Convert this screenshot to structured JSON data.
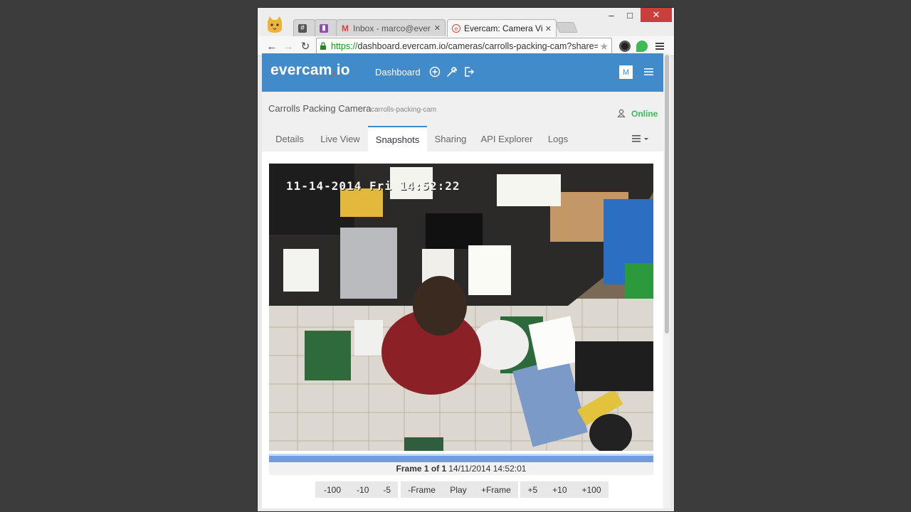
{
  "browser": {
    "tabs": [
      {
        "label": "",
        "icon": "hashtag-icon"
      },
      {
        "label": "",
        "icon": "trello-icon"
      },
      {
        "label": "Inbox - marco@ever",
        "icon": "gmail-icon"
      },
      {
        "label": "Evercam: Camera Vie",
        "icon": "evercam-icon",
        "active": true
      }
    ],
    "url_scheme": "https://",
    "url_rest": "dashboard.evercam.io/cameras/carrolls-packing-cam?share=",
    "window_buttons": {
      "minimize": "–",
      "maximize": "□",
      "close": "✕"
    },
    "nav": {
      "back": "←",
      "forward": "→",
      "reload": "↻"
    },
    "colors": {
      "url_green": "#1a8d1a",
      "close_red": "#c9403a"
    }
  },
  "app": {
    "logo_main": "evercam",
    "logo_dot": ".",
    "logo_tail": "io",
    "nav_dashboard": "Dashboard",
    "avatar": "M",
    "colors": {
      "header": "#428bca",
      "online": "#3cba54"
    }
  },
  "camera": {
    "name": "Carrolls Packing Camera",
    "id": "carrolls-packing-cam",
    "status": "Online"
  },
  "tabs": [
    "Details",
    "Live View",
    "Snapshots",
    "Sharing",
    "API Explorer",
    "Logs"
  ],
  "active_tab": "Snapshots",
  "snapshot": {
    "overlay_timestamp": "11-14-2014 Fri 14:52:22",
    "frame_label": "Frame 1 of 1",
    "frame_time": "14/11/2014 14:52:01",
    "progress": 1.0
  },
  "controls": {
    "group1": [
      "-100",
      "-10",
      "-5"
    ],
    "group2": [
      "-Frame",
      "Play",
      "+Frame"
    ],
    "group3": [
      "+5",
      "+10",
      "+100"
    ]
  }
}
